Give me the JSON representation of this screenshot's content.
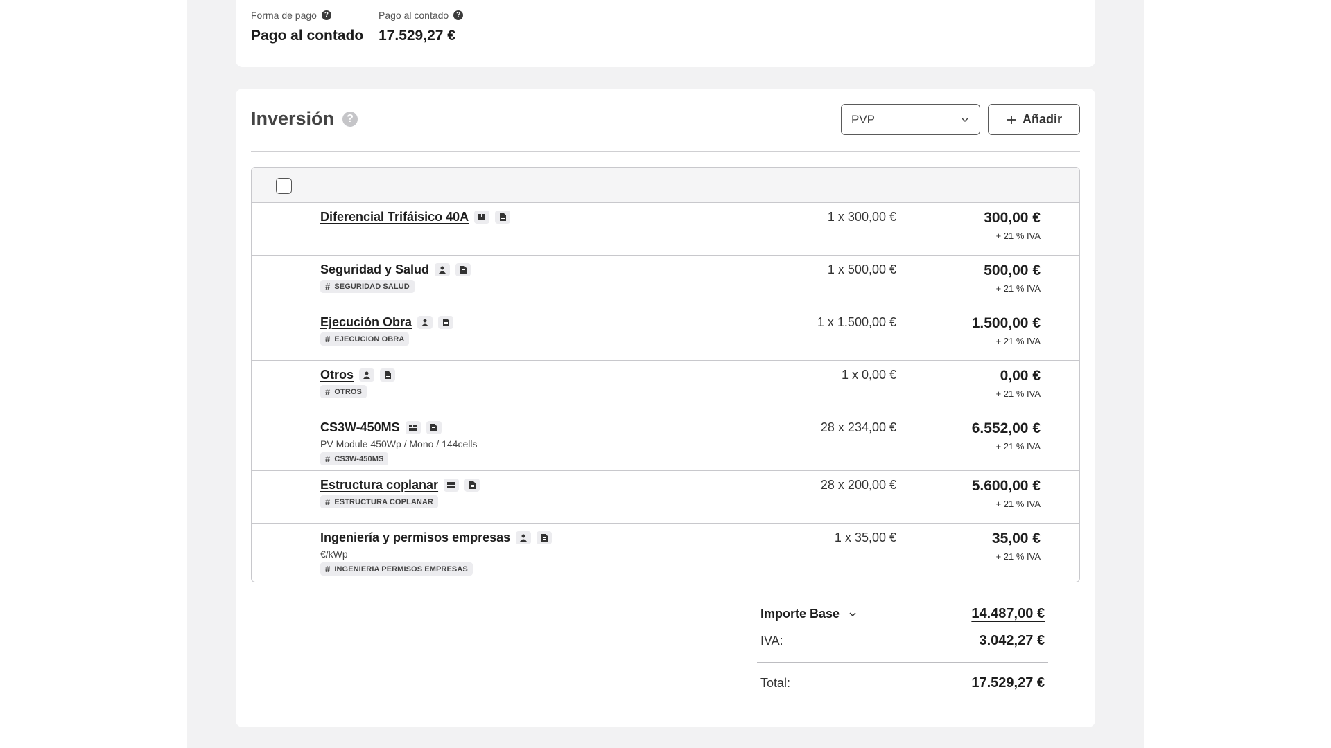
{
  "payment": {
    "method_label": "Forma de pago",
    "method_value": "Pago al contado",
    "amount_label": "Pago al contado",
    "amount_value": "17.529,27 €"
  },
  "investment": {
    "title": "Inversión",
    "price_select": "PVP",
    "add_label": "Añadir",
    "vat_note": "+ 21 % IVA",
    "items": [
      {
        "name": "Diferencial Trifáisico 40A",
        "icon": "group-icon",
        "desc": "",
        "tag": "",
        "qty": "1 x 300,00 €",
        "price": "300,00 €"
      },
      {
        "name": "Seguridad y Salud",
        "icon": "person-icon",
        "desc": "",
        "tag": "SEGURIDAD SALUD",
        "qty": "1 x 500,00 €",
        "price": "500,00 €"
      },
      {
        "name": "Ejecución Obra",
        "icon": "person-icon",
        "desc": "",
        "tag": "EJECUCION OBRA",
        "qty": "1 x 1.500,00 €",
        "price": "1.500,00 €"
      },
      {
        "name": "Otros",
        "icon": "person-icon",
        "desc": "",
        "tag": "OTROS",
        "qty": "1 x 0,00 €",
        "price": "0,00 €"
      },
      {
        "name": "CS3W-450MS",
        "icon": "group-icon",
        "desc": "PV Module 450Wp / Mono / 144cells",
        "tag": "CS3W-450MS",
        "qty": "28 x 234,00 €",
        "price": "6.552,00 €"
      },
      {
        "name": "Estructura coplanar",
        "icon": "group-icon",
        "desc": "",
        "tag": "ESTRUCTURA COPLANAR",
        "qty": "28 x 200,00 €",
        "price": "5.600,00 €"
      },
      {
        "name": "Ingeniería y permisos empresas",
        "icon": "person-icon",
        "desc": "€/kWp",
        "tag": "INGENIERIA PERMISOS EMPRESAS",
        "qty": "1 x 35,00 €",
        "price": "35,00 €"
      }
    ]
  },
  "totals": {
    "base_label": "Importe Base",
    "base_value": "14.487,00 €",
    "vat_label": "IVA:",
    "vat_value": "3.042,27 €",
    "total_label": "Total:",
    "total_value": "17.529,27 €"
  }
}
